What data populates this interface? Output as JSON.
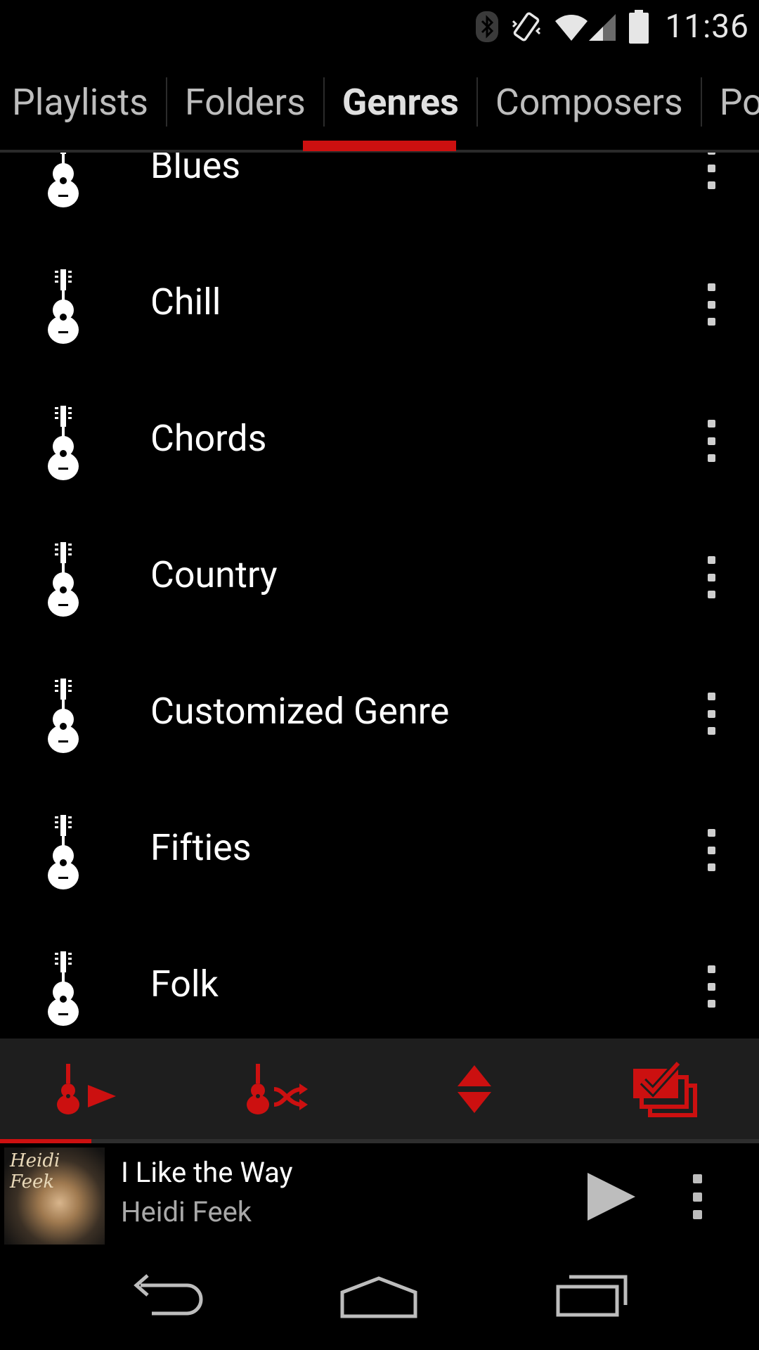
{
  "status_bar": {
    "time": "11:36",
    "icons": [
      "bluetooth-icon",
      "vibrate-icon",
      "wifi-icon",
      "cell-signal-icon",
      "battery-icon"
    ]
  },
  "tabs": [
    {
      "label": "Playlists",
      "active": false
    },
    {
      "label": "Folders",
      "active": false
    },
    {
      "label": "Genres",
      "active": true
    },
    {
      "label": "Composers",
      "active": false
    },
    {
      "label": "Pod",
      "active": false
    }
  ],
  "genres": [
    {
      "label": "Blues",
      "icon": "guitar-icon"
    },
    {
      "label": "Chill",
      "icon": "guitar-icon"
    },
    {
      "label": "Chords",
      "icon": "guitar-icon"
    },
    {
      "label": "Country",
      "icon": "guitar-icon"
    },
    {
      "label": "Customized Genre",
      "icon": "guitar-icon"
    },
    {
      "label": "Fifties",
      "icon": "guitar-icon"
    },
    {
      "label": "Folk",
      "icon": "guitar-icon"
    }
  ],
  "action_bar": {
    "buttons": [
      "play-genre-icon",
      "shuffle-genre-icon",
      "sort-icon",
      "select-multiple-icon"
    ]
  },
  "now_playing": {
    "album_art_text": "Heidi Feek",
    "title": "I Like the Way",
    "artist": "Heidi Feek",
    "progress_fraction": 0.12
  },
  "nav_bar": {
    "buttons": [
      "back-icon",
      "home-icon",
      "recents-icon"
    ]
  },
  "colors": {
    "accent": "#cc1010",
    "background": "#000000",
    "action_bar_bg": "#1e1e1e",
    "text_primary": "#ffffff",
    "text_secondary": "#a9a9a9"
  }
}
